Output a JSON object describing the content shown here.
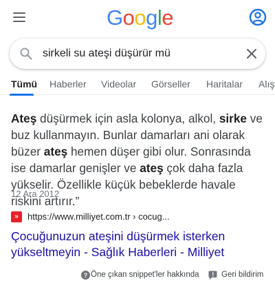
{
  "header": {
    "logo_letters": [
      "G",
      "o",
      "o",
      "g",
      "l",
      "e"
    ],
    "logo_colors": [
      "#4285f4",
      "#ea4335",
      "#fbbc05",
      "#4285f4",
      "#34a853",
      "#ea4335"
    ],
    "menu_icon": "hamburger-menu-icon",
    "account_icon": "account-circle-icon"
  },
  "search": {
    "query": "sirkeli su ateşi düşürür mü",
    "search_icon": "search-icon",
    "clear_icon": "clear-icon"
  },
  "tabs": [
    {
      "label": "Tümü",
      "active": true
    },
    {
      "label": "Haberler",
      "active": false
    },
    {
      "label": "Videolar",
      "active": false
    },
    {
      "label": "Görseller",
      "active": false
    },
    {
      "label": "Haritalar",
      "active": false
    },
    {
      "label": "Alışv",
      "active": false
    }
  ],
  "featured_snippet": {
    "parts": [
      {
        "text": "Ateş",
        "bold": true
      },
      {
        "text": " düşürmek için asla kolonya, alkol, ",
        "bold": false
      },
      {
        "text": "sirke",
        "bold": true
      },
      {
        "text": " ve buz kullanmayın. Bunlar damarları ani olarak büzer ",
        "bold": false
      },
      {
        "text": "ateş",
        "bold": true
      },
      {
        "text": " hemen düşer gibi olur. Sonrasında ise damarlar genişler ve ",
        "bold": false
      },
      {
        "text": "ateş",
        "bold": true
      },
      {
        "text": " çok daha fazla yükselir. Özellikle küçük bebeklerde havale riskini artırır.”",
        "bold": false
      }
    ],
    "date": "12 Ara 2012"
  },
  "result": {
    "favicon_text": "»",
    "source_url": "https://www.milliyet.com.tr › cocug...",
    "title": "Çocuğunuzun ateşini düşürmek isterken yükseltmeyin - Sağlık Haberleri - Milliyet"
  },
  "footer": {
    "about_label": "Öne çıkan snippet'ler hakkında",
    "feedback_label": "Geri bildirim",
    "help_icon": "help-circle-icon",
    "feedback_icon": "feedback-icon"
  },
  "colors": {
    "accent": "#1a73e8",
    "link": "#1a0dab",
    "favicon": "#e8212a"
  }
}
